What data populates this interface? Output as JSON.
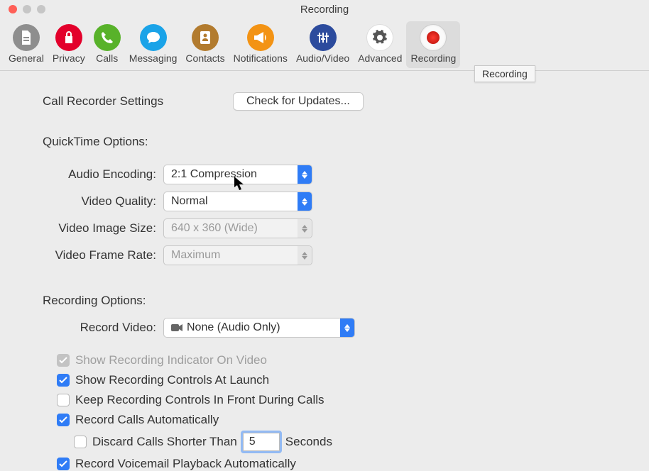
{
  "window": {
    "title": "Recording"
  },
  "toolbar": {
    "items": [
      {
        "label": "General",
        "color": "#8e8e8e",
        "icon": "file"
      },
      {
        "label": "Privacy",
        "color": "#e3002b",
        "icon": "lock"
      },
      {
        "label": "Calls",
        "color": "#58b22a",
        "icon": "phone"
      },
      {
        "label": "Messaging",
        "color": "#1aa3e8",
        "icon": "chat"
      },
      {
        "label": "Contacts",
        "color": "#b27b2e",
        "icon": "book"
      },
      {
        "label": "Notifications",
        "color": "#f39314",
        "icon": "bullhorn"
      },
      {
        "label": "Audio/Video",
        "color": "#2c4b9d",
        "icon": "sliders"
      },
      {
        "label": "Advanced",
        "color": "#ffffff",
        "icon": "gear"
      },
      {
        "label": "Recording",
        "color": "#d8d8d8",
        "icon": "record"
      }
    ]
  },
  "tooltip": {
    "text": "Recording"
  },
  "settings": {
    "header": "Call Recorder Settings",
    "updateButton": "Check for Updates..."
  },
  "quicktime": {
    "header": "QuickTime Options:",
    "audioEncodingLabel": "Audio Encoding:",
    "audioEncodingValue": "2:1 Compression",
    "videoQualityLabel": "Video Quality:",
    "videoQualityValue": "Normal",
    "videoImageSizeLabel": "Video Image Size:",
    "videoImageSizeValue": "640 x 360 (Wide)",
    "videoFrameRateLabel": "Video Frame Rate:",
    "videoFrameRateValue": "Maximum"
  },
  "recording": {
    "header": "Recording Options:",
    "recordVideoLabel": "Record Video:",
    "recordVideoValue": "None (Audio Only)",
    "showIndicator": "Show Recording Indicator On Video",
    "showControls": "Show Recording Controls At Launch",
    "keepFront": "Keep Recording Controls In Front During Calls",
    "recordAuto": "Record Calls Automatically",
    "discardPrefix": "Discard Calls Shorter Than",
    "discardValue": "5",
    "discardSuffix": "Seconds",
    "recordVoicemail": "Record Voicemail Playback Automatically"
  }
}
